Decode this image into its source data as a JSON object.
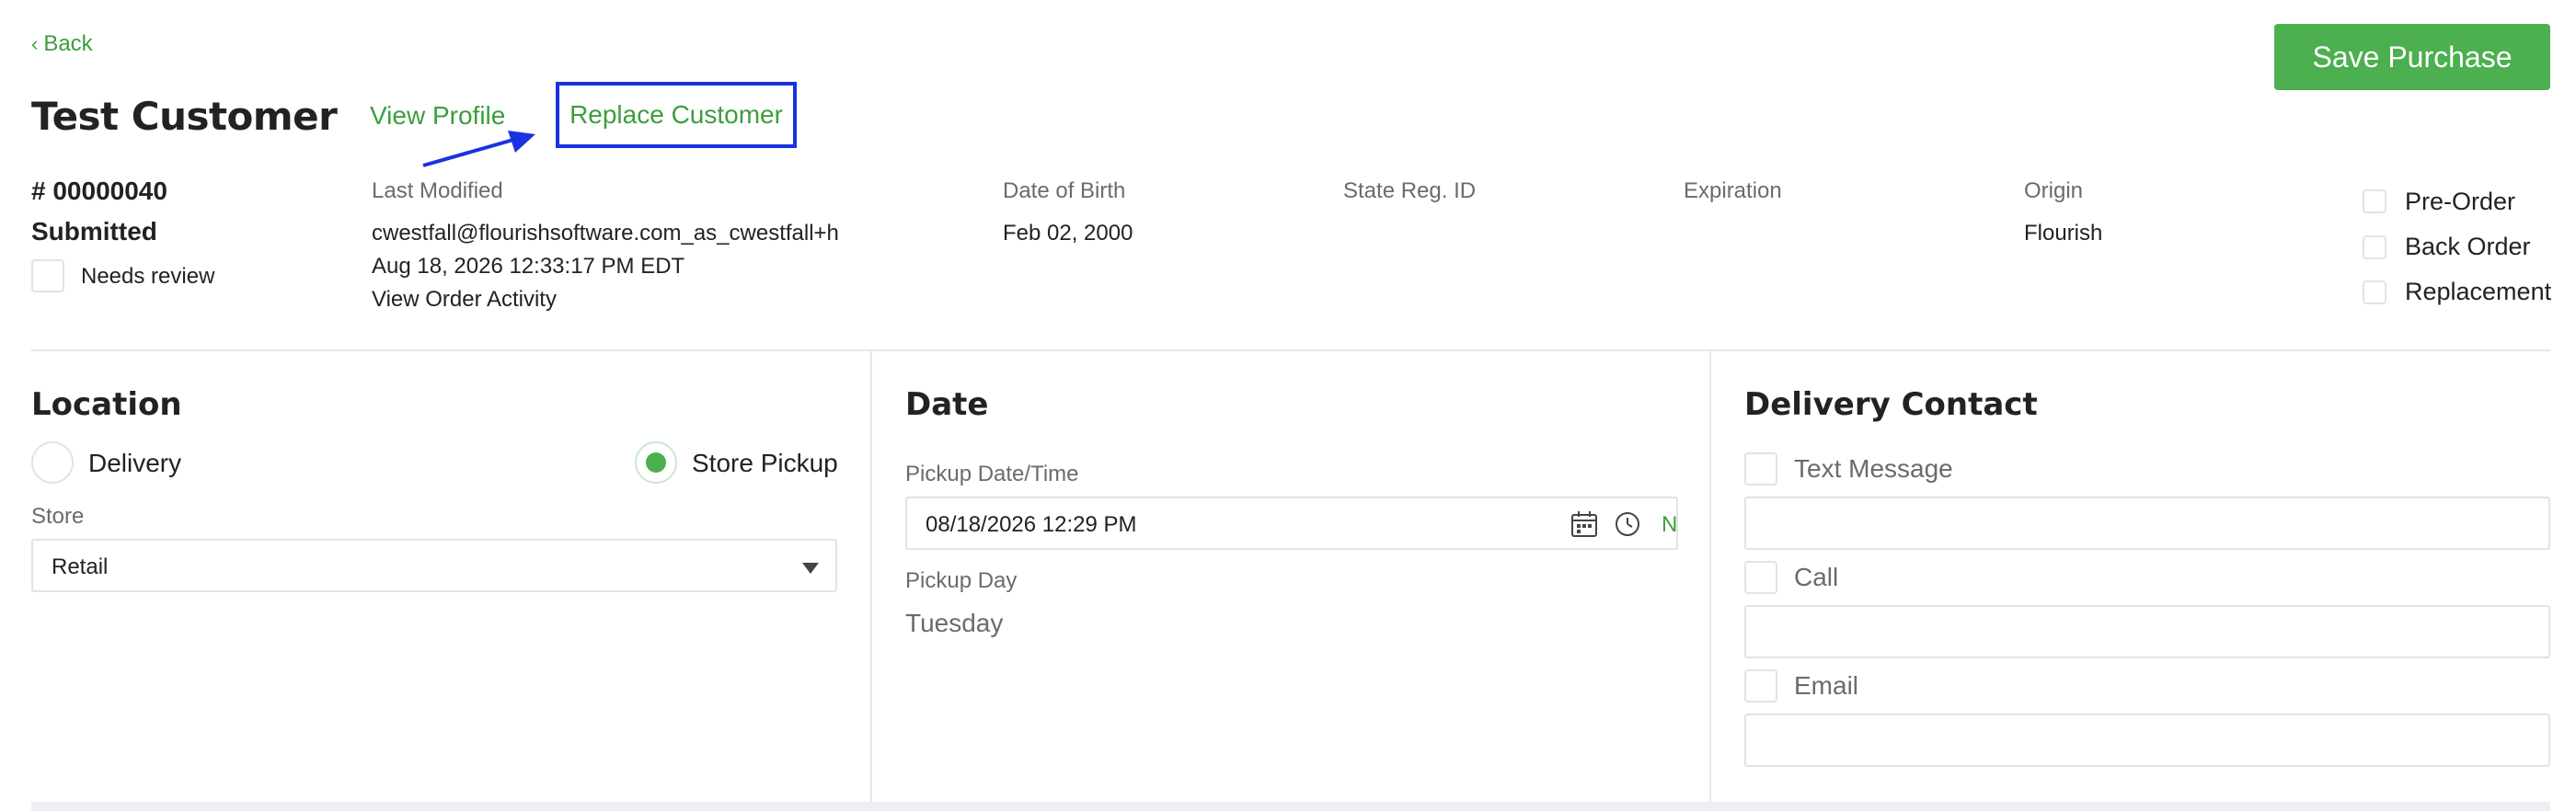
{
  "header": {
    "back_label": "Back",
    "customer_name": "Test Customer",
    "view_profile": "View Profile",
    "replace_customer": "Replace Customer",
    "save_purchase": "Save Purchase"
  },
  "order": {
    "number": "# 00000040",
    "status": "Submitted",
    "needs_review_label": "Needs review",
    "last_modified_label": "Last Modified",
    "last_modified_by": "cwestfall@flourishsoftware.com_as_cwestfall+h",
    "last_modified_at": "Aug 18, 2026 12:33:17 PM EDT",
    "view_order_activity": "View Order Activity",
    "dob_label": "Date of Birth",
    "dob_value": "Feb 02, 2000",
    "state_reg_label": "State Reg. ID",
    "expiration_label": "Expiration",
    "origin_label": "Origin",
    "origin_value": "Flourish",
    "flags": [
      "Pre-Order",
      "Back Order",
      "Replacement"
    ]
  },
  "location": {
    "title": "Location",
    "delivery_label": "Delivery",
    "store_pickup_label": "Store Pickup",
    "selected": "Store Pickup",
    "store_label": "Store",
    "store_value": "Retail"
  },
  "date": {
    "title": "Date",
    "pickup_datetime_label": "Pickup Date/Time",
    "pickup_datetime_value": "08/18/2026 12:29 PM",
    "now_fragment": "N",
    "pickup_day_label": "Pickup Day",
    "pickup_day_value": "Tuesday"
  },
  "delivery_contact": {
    "title": "Delivery Contact",
    "text_message_label": "Text Message",
    "call_label": "Call",
    "email_label": "Email"
  },
  "colors": {
    "accent_green": "#4caf50",
    "link_green": "#3c9e3c",
    "annotation_blue": "#1a32e0"
  },
  "icons": {
    "back": "chevron-left-icon",
    "calendar": "calendar-icon",
    "clock": "clock-icon",
    "select": "caret-down-icon"
  }
}
